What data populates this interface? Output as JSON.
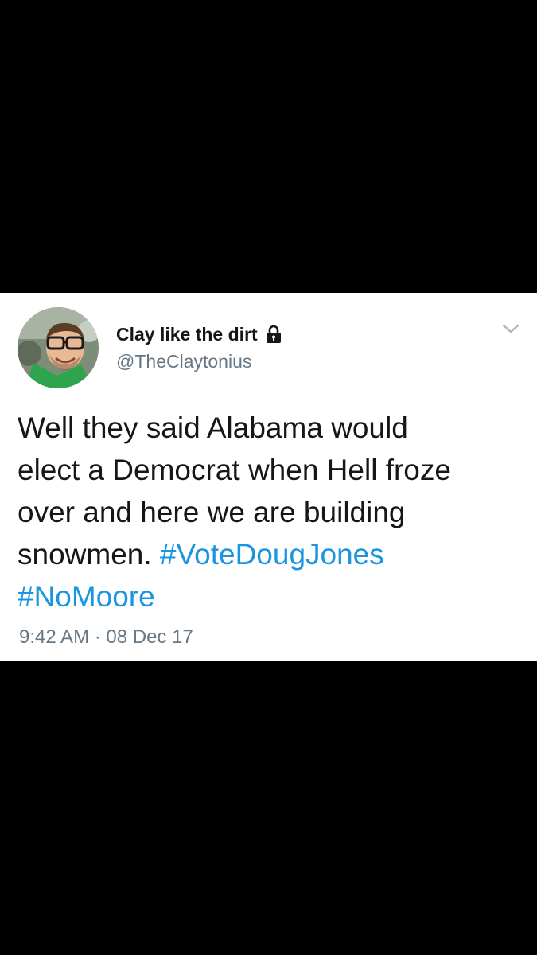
{
  "tweet": {
    "display_name": "Clay like the dirt",
    "handle": "@TheClaytonius",
    "text_lines": [
      "Well they said Alabama would",
      "elect a Democrat when Hell froze",
      "over and here we are building",
      "snowmen."
    ],
    "hashtags": [
      "#VoteDougJones",
      "#NoMoore"
    ],
    "timestamp": "9:42 AM · 08 Dec 17",
    "icons": {
      "protected": "lock-icon",
      "menu": "chevron-down-icon"
    }
  },
  "colors": {
    "background": "#000000",
    "card": "#ffffff",
    "text": "#14171a",
    "secondary": "#657786",
    "link": "#1b95e0"
  }
}
